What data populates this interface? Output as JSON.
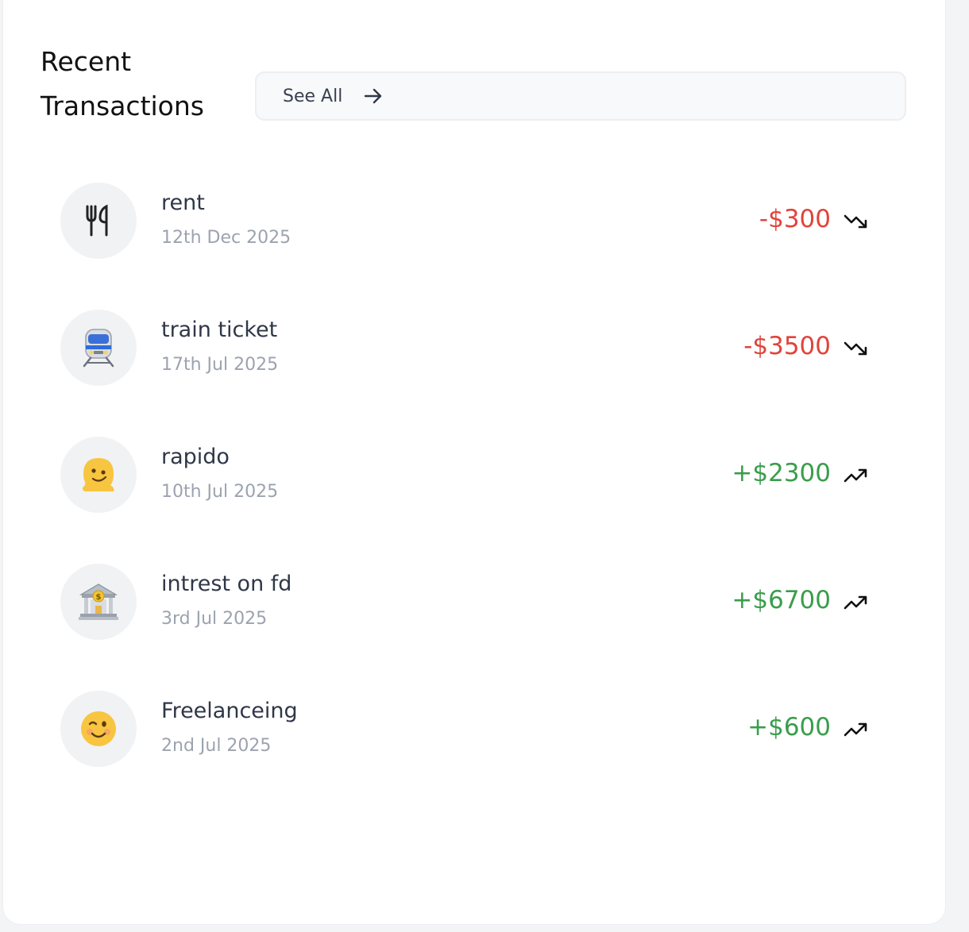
{
  "header": {
    "title": "Recent Transactions",
    "see_all_label": "See All"
  },
  "colors": {
    "negative": "#e0443c",
    "positive": "#3a9d4b"
  },
  "transactions": [
    {
      "name": "rent",
      "date": "12th Dec 2025",
      "amount": "-$300",
      "direction": "down",
      "icon": "fork-knife-icon"
    },
    {
      "name": "train ticket",
      "date": "17th Jul 2025",
      "amount": "-$3500",
      "direction": "down",
      "icon": "train-emoji-icon"
    },
    {
      "name": "rapido",
      "date": "10th Jul 2025",
      "amount": "+$2300",
      "direction": "up",
      "icon": "melting-face-emoji-icon"
    },
    {
      "name": "intrest on fd",
      "date": "3rd Jul 2025",
      "amount": "+$6700",
      "direction": "up",
      "icon": "bank-emoji-icon"
    },
    {
      "name": "Freelanceing",
      "date": "2nd Jul 2025",
      "amount": "+$600",
      "direction": "up",
      "icon": "winking-face-emoji-icon"
    }
  ]
}
